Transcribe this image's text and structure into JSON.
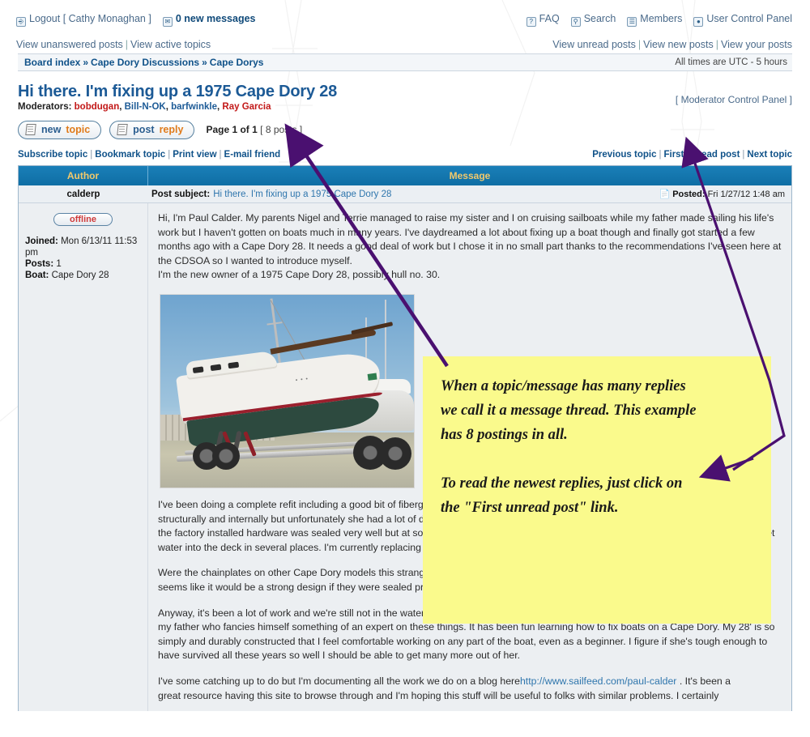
{
  "topnav": {
    "logout": "Logout [ Cathy Monaghan ]",
    "logout_icon": "power-icon",
    "messages_count": "0",
    "messages_label": "new messages",
    "messages_icon": "envelope-icon",
    "links": [
      {
        "label": "FAQ",
        "icon": "question-icon"
      },
      {
        "label": "Search",
        "icon": "search-icon"
      },
      {
        "label": "Members",
        "icon": "members-icon"
      },
      {
        "label": "User Control Panel",
        "icon": "user-icon"
      }
    ],
    "left_row2": [
      "View unanswered posts",
      "View active topics"
    ],
    "right_row2": [
      "View unread posts",
      "View new posts",
      "View your posts"
    ]
  },
  "breadcrumb": {
    "items": [
      "Board index",
      "Cape Dory Discussions",
      "Cape Dorys"
    ],
    "arrow": "»",
    "times": "All times are UTC - 5 hours"
  },
  "topic": {
    "title": "Hi there. I'm fixing up a 1975 Cape Dory 28",
    "moderators_label": "Moderators:",
    "moderators": [
      "bobdugan",
      "Bill-N-OK",
      "barfwinkle",
      "Ray Garcia"
    ],
    "moderator_control_panel": "[ Moderator Control Panel ]"
  },
  "actions": {
    "new_topic_1": "new",
    "new_topic_2": "topic",
    "post_reply_1": "post",
    "post_reply_2": "reply",
    "page_of": "Page 1 of 1",
    "post_count": "[ 8 posts ]"
  },
  "sublinks": {
    "left": [
      "Subscribe topic",
      "Bookmark topic",
      "Print view",
      "E-mail friend"
    ],
    "right": [
      "Previous topic",
      "First unread post",
      "Next topic"
    ],
    "separator": "|"
  },
  "table": {
    "header_author": "Author",
    "header_message": "Message",
    "author": "calderp",
    "post_subject_label": "Post subject:",
    "post_subject": "Hi there. I'm fixing up a 1975 Cape Dory 28",
    "posted_label": "Posted:",
    "posted_value": "Fri 1/27/12 1:48 am",
    "posted_icon": "post-icon",
    "status": "offline",
    "joined_label": "Joined:",
    "joined_value": "Mon 6/13/11 11:53 pm",
    "posts_label": "Posts:",
    "posts_value": "1",
    "boat_label": "Boat:",
    "boat_value": "Cape Dory 28"
  },
  "post": {
    "para1": "Hi, I'm Paul Calder. My parents Nigel and Terrie managed to raise my sister and I on cruising sailboats while my father made sailing his life's work but I haven't gotten on boats much in many years. I've daydreamed a lot about fixing up a boat though and finally got started a few months ago with a Cape Dory 28. It needs a good deal of work but I chose it in no small part thanks to the recommendations I've seen here at the CDSOA so I wanted to introduce myself.",
    "para2": "I'm the new owner of a 1975 Cape Dory 28, possibly hull no. 30.",
    "photo_alt": "sailboat-on-trailer-photo",
    "para3": "I've been doing a complete refit including a good bit of fiberglass work and rebedding of all deck hardware. She was in pretty good shape structurally and internally but unfortunately she had a lot of deck core rot around the fittings. I was very impressed to find that virtually all of the factory installed hardware was sealed very well but at some point in her life someone down the line did a much more slipshod job and let water into the deck in several places. I'm currently replacing the chainplates which this water completely rusted out.",
    "para4": "Were the chainplates on other Cape Dory models this strange? Mine were not bedded or sealed at all and sat in wet spots! Odd as it is it seems like it would be a strong design if they were sealed properly, you could inspect them with your fingernails.",
    "para5": "Anyway, it's been a lot of work and we're still not in the water yet. I've been very lucky though to have a lot of help from a couple friends and my father who fancies himself something of an expert on these things. It has been fun learning how to fix boats on a Cape Dory. My 28' is so simply and durably constructed that I feel comfortable working on any part of the boat, even as a beginner. I figure if she's tough enough to have survived all these years so well I should be able to get many more out of her.",
    "para6_pre": "I've some catching up to do but I'm documenting all the work we do on a blog here",
    "para6_link": "http://www.sailfeed.com/paul-calder",
    "para6_post": " . It's been a",
    "para7": "great resource having this site to browse through and I'm hoping this stuff will be useful to folks with similar problems. I certainly"
  },
  "annotation": {
    "line1": "When a topic/message has many replies",
    "line2": "we call it a message thread.  This example",
    "line3": "has 8 postings in all.",
    "line4": "To read the newest replies, just click on",
    "line5": "the \"First unread post\" link.",
    "arrow_color": "#4a1070",
    "background": "#fafa8c"
  },
  "colors": {
    "header_bar": "#0f6ea4",
    "header_text": "#f2c96b",
    "link": "#105289",
    "title": "#1c5a96",
    "accent_orange": "#e07b1b",
    "moderator_red": "#c21818"
  }
}
